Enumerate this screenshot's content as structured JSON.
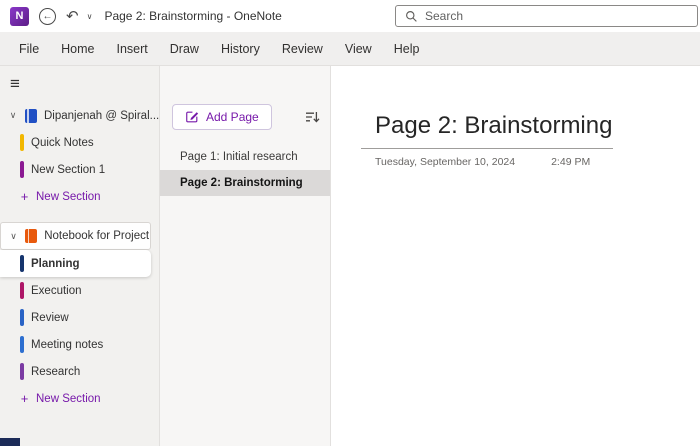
{
  "colors": {
    "accent": "#7719aa",
    "titlebar_bg": "#ffffff",
    "menubar_bg": "#f0efee",
    "sidebar_bg": "#f2f1ef",
    "pages_bg": "#f7f6f5",
    "selected_page_bg": "#dbd9d8"
  },
  "titlebar": {
    "app_icon_letter": "N",
    "title": "Page 2: Brainstorming  -  OneNote",
    "search_placeholder": "Search"
  },
  "menubar": {
    "items": [
      "File",
      "Home",
      "Insert",
      "Draw",
      "History",
      "Review",
      "View",
      "Help"
    ]
  },
  "sidebar": {
    "notebooks": [
      {
        "name": "Dipanjenah @ Spiral...",
        "icon_color": "#2150c4",
        "sections": [
          {
            "name": "Quick Notes",
            "color": "#f2b700",
            "selected": false
          },
          {
            "name": "New Section 1",
            "color": "#8b1a92",
            "selected": false
          }
        ],
        "new_section_label": "New Section"
      },
      {
        "name": "Notebook for Project A",
        "icon_color": "#e8590c",
        "sections": [
          {
            "name": "Planning",
            "color": "#16356d",
            "selected": true
          },
          {
            "name": "Execution",
            "color": "#ae1767",
            "selected": false
          },
          {
            "name": "Review",
            "color": "#2a63c5",
            "selected": false
          },
          {
            "name": "Meeting notes",
            "color": "#2d6fd0",
            "selected": false
          },
          {
            "name": "Research",
            "color": "#7b3ba3",
            "selected": false
          }
        ],
        "new_section_label": "New Section"
      }
    ]
  },
  "pages_pane": {
    "add_page_label": "Add Page",
    "pages": [
      {
        "title": "Page 1: Initial research",
        "selected": false
      },
      {
        "title": "Page 2: Brainstorming",
        "selected": true
      }
    ]
  },
  "content": {
    "page_title": "Page 2: Brainstorming",
    "date": "Tuesday, September 10, 2024",
    "time": "2:49 PM"
  }
}
